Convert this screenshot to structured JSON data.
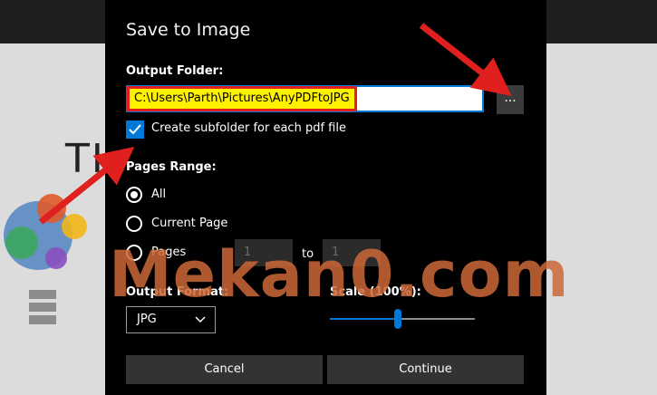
{
  "dialog": {
    "title": "Save to Image",
    "output_folder_label": "Output Folder:",
    "output_folder_value": "C:\\Users\\Parth\\Pictures\\AnyPDFtoJPG",
    "browse_label": "...",
    "subfolder_label": "Create subfolder for each pdf file",
    "subfolder_checked": true,
    "pages_range_label": "Pages Range:",
    "radio_options": [
      "All",
      "Current Page",
      "Pages"
    ],
    "selected_radio": "All",
    "pages_from": "1",
    "pages_to_label": "to",
    "pages_to": "1",
    "output_format_label": "Output Format:",
    "output_format_value": "JPG",
    "scale_label": "Scale (100%):",
    "scale_value": 0.47,
    "cancel_label": "Cancel",
    "continue_label": "Continue"
  },
  "background": {
    "partial_text": "TI"
  },
  "watermark": {
    "text": "Mekan0.com"
  },
  "colors": {
    "accent": "#0078d7",
    "highlight_fill": "#fff200",
    "highlight_border": "#e0201f",
    "arrow": "#e0201f",
    "watermark": "#cd6737"
  },
  "icons": [
    "check-icon",
    "chevron-down-icon",
    "ellipsis-icon",
    "arrow-annotation-icon",
    "gear-logo-icon"
  ]
}
